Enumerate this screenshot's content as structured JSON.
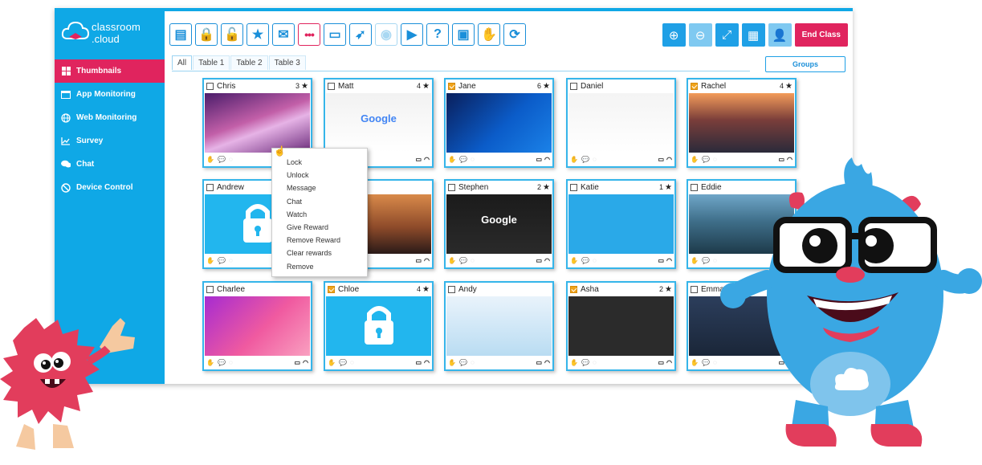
{
  "app": {
    "logo_line1": "classroom",
    "logo_line2": ".cloud"
  },
  "sidebar": {
    "items": [
      {
        "label": "Thumbnails",
        "icon": "grid-icon",
        "active": true
      },
      {
        "label": "App Monitoring",
        "icon": "window-icon"
      },
      {
        "label": "Web Monitoring",
        "icon": "globe-icon"
      },
      {
        "label": "Survey",
        "icon": "chart-icon"
      },
      {
        "label": "Chat",
        "icon": "chat-icon"
      },
      {
        "label": "Device Control",
        "icon": "block-icon"
      }
    ]
  },
  "toolbar": {
    "buttons": [
      {
        "name": "register-icon",
        "glyph": "▤"
      },
      {
        "name": "lock-icon",
        "glyph": "🔒"
      },
      {
        "name": "unlock-icon",
        "glyph": "🔓"
      },
      {
        "name": "reward-icon",
        "glyph": "★"
      },
      {
        "name": "message-icon",
        "glyph": "✉"
      },
      {
        "name": "more-icon",
        "glyph": "•••",
        "red": true
      },
      {
        "name": "monitor-icon",
        "glyph": "▭"
      },
      {
        "name": "rocket-icon",
        "glyph": "➶"
      },
      {
        "name": "eye-icon",
        "glyph": "◉",
        "dim": true
      },
      {
        "name": "play-icon",
        "glyph": "▶"
      },
      {
        "name": "help-icon",
        "glyph": "?"
      },
      {
        "name": "presenter-icon",
        "glyph": "▣"
      },
      {
        "name": "hand-icon",
        "glyph": "✋"
      },
      {
        "name": "refresh-icon",
        "glyph": "⟳"
      }
    ],
    "right": [
      {
        "name": "zoom-in-icon",
        "glyph": "⊕"
      },
      {
        "name": "zoom-out-icon",
        "glyph": "⊖",
        "light": true
      },
      {
        "name": "fullscreen-icon",
        "glyph": "⤢"
      },
      {
        "name": "layout-icon",
        "glyph": "▦"
      },
      {
        "name": "user-icon",
        "glyph": "👤",
        "light": true
      }
    ],
    "end_class": "End Class"
  },
  "tabs": [
    "All",
    "Table 1",
    "Table 2",
    "Table 3"
  ],
  "groups_label": "Groups",
  "students": [
    {
      "name": "Chris",
      "score": "3",
      "checked": false
    },
    {
      "name": "Matt",
      "score": "4",
      "checked": false
    },
    {
      "name": "Jane",
      "score": "6",
      "checked": true
    },
    {
      "name": "Daniel",
      "score": "",
      "checked": false
    },
    {
      "name": "Rachel",
      "score": "4",
      "checked": true
    },
    {
      "name": "Andrew",
      "score": "",
      "checked": false
    },
    {
      "name": "",
      "score": "",
      "checked": false
    },
    {
      "name": "Stephen",
      "score": "2",
      "checked": false
    },
    {
      "name": "Katie",
      "score": "1",
      "checked": false
    },
    {
      "name": "Eddie",
      "score": "",
      "checked": false
    },
    {
      "name": "Charlee",
      "score": "",
      "checked": false
    },
    {
      "name": "Chloe",
      "score": "4",
      "checked": true
    },
    {
      "name": "Andy",
      "score": "",
      "checked": false
    },
    {
      "name": "Asha",
      "score": "2",
      "checked": true
    },
    {
      "name": "Emma",
      "score": "",
      "checked": false
    }
  ],
  "thumb_labels": {
    "google": "Google"
  },
  "context_menu": [
    "Lock",
    "Unlock",
    "Message",
    "Chat",
    "Watch",
    "Give Reward",
    "Remove Reward",
    "Clear rewards",
    "Remove"
  ],
  "colors": {
    "brand": "#0fa8e6",
    "accent": "#e0245e",
    "check": "#f0a31b"
  }
}
